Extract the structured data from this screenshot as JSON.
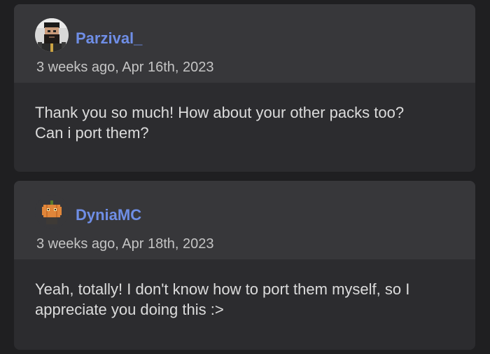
{
  "comments": [
    {
      "username": "Parzival_",
      "timestamp": "3 weeks ago, Apr 16th, 2023",
      "lines": [
        "Thank you so much! How about your other packs too?",
        "Can i port them?"
      ],
      "avatar_icon": "pixel-bearded-man-avatar"
    },
    {
      "username": "DyniaMC",
      "timestamp": "3 weeks ago, Apr 18th, 2023",
      "lines": [
        "Yeah, totally! I don't know how to port them myself, so I",
        "appreciate you doing this :>"
      ],
      "avatar_icon": "pixel-pumpkin-avatar"
    }
  ],
  "colors": {
    "background": "#1f1f21",
    "card": "#2c2c2f",
    "card_header": "#37373a",
    "username": "#6f8ee6",
    "text": "#dcdcdc"
  }
}
